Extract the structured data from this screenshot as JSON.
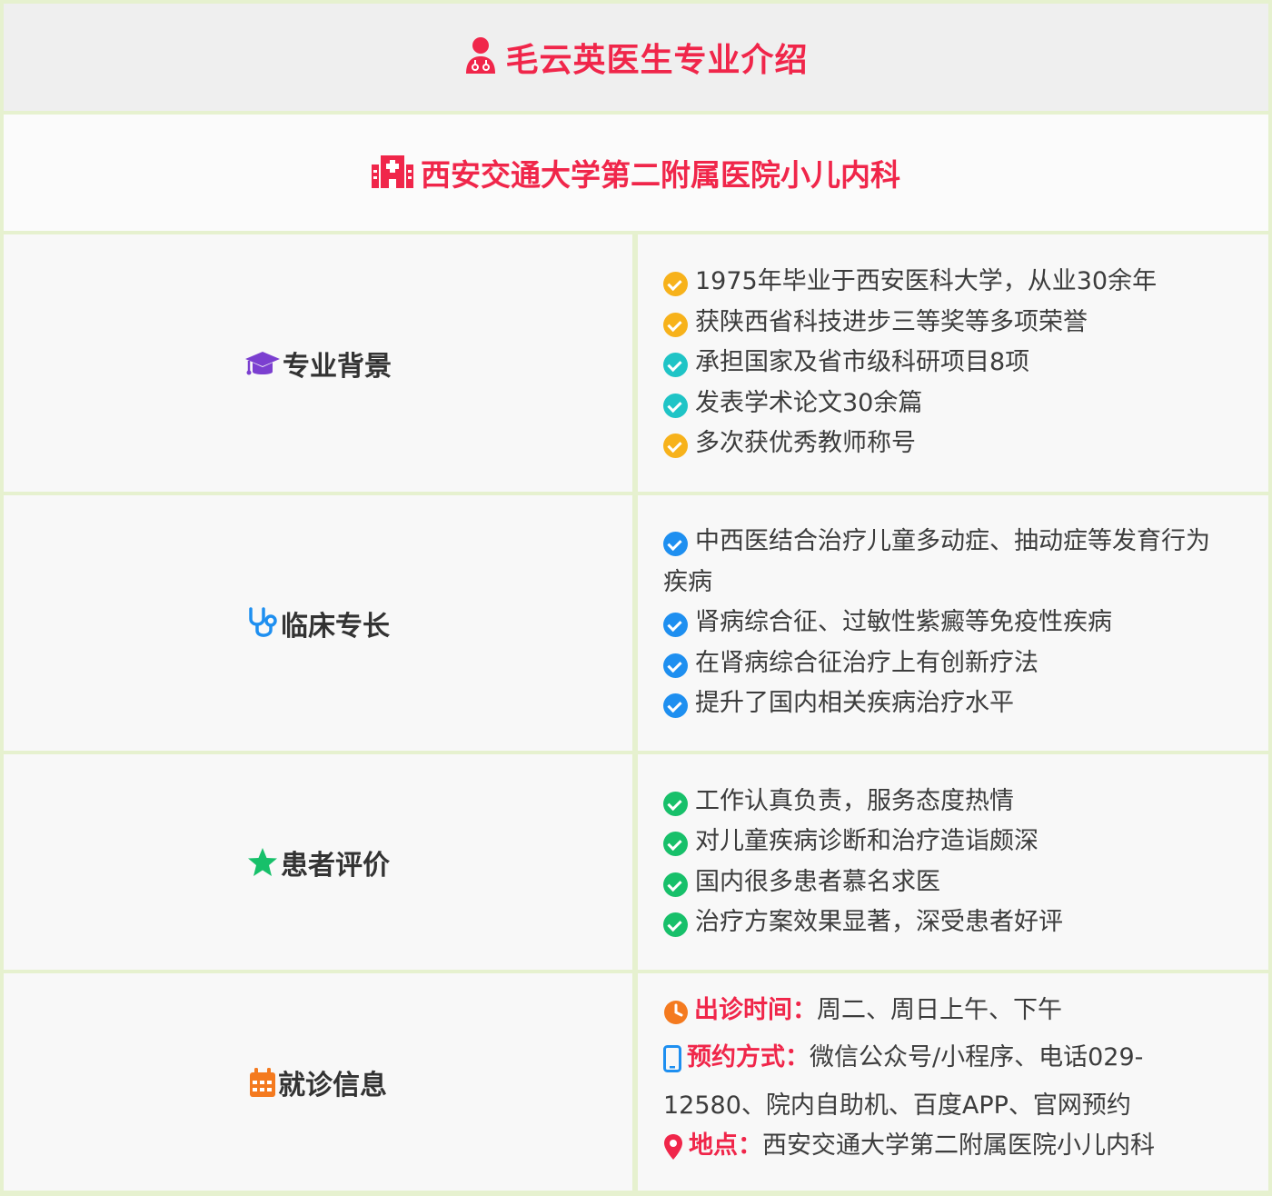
{
  "header": {
    "title": "毛云英医生专业介绍",
    "hospital": "西安交通大学第二附属医院小儿内科"
  },
  "sections": {
    "background": {
      "label": "专业背景",
      "icon": "graduation-cap-icon",
      "items": [
        "1975年毕业于西安医科大学，从业30余年",
        "获陕西省科技进步三等奖等多项荣誉",
        "承担国家及省市级科研项目8项",
        "发表学术论文30余篇",
        "多次获优秀教师称号"
      ]
    },
    "specialty": {
      "label": "临床专长",
      "icon": "stethoscope-icon",
      "items": [
        "中西医结合治疗儿童多动症、抽动症等发育行为疾病",
        "肾病综合征、过敏性紫癜等免疫性疾病",
        "在肾病综合征治疗上有创新疗法",
        "提升了国内相关疾病治疗水平"
      ]
    },
    "reviews": {
      "label": "患者评价",
      "icon": "star-icon",
      "items": [
        "工作认真负责，服务态度热情",
        "对儿童疾病诊断和治疗造诣颇深",
        "国内很多患者慕名求医",
        "治疗方案效果显著，深受患者好评"
      ]
    },
    "visit": {
      "label": "就诊信息",
      "icon": "calendar-icon",
      "time_key": "出诊时间：",
      "time_value": "周二、周日上午、下午",
      "booking_key": "预约方式：",
      "booking_value": "微信公众号/小程序、电话029-12580、院内自助机、百度APP、官网预约",
      "location_key": "地点：",
      "location_value": "西安交通大学第二附属医院小儿内科"
    }
  },
  "colors": {
    "accent": "#f0264a",
    "check_orange": "#f7b21b",
    "check_teal": "#1fc4c6",
    "check_blue": "#1e8ff0",
    "check_green": "#17c06a",
    "border": "#e6f1cf"
  }
}
